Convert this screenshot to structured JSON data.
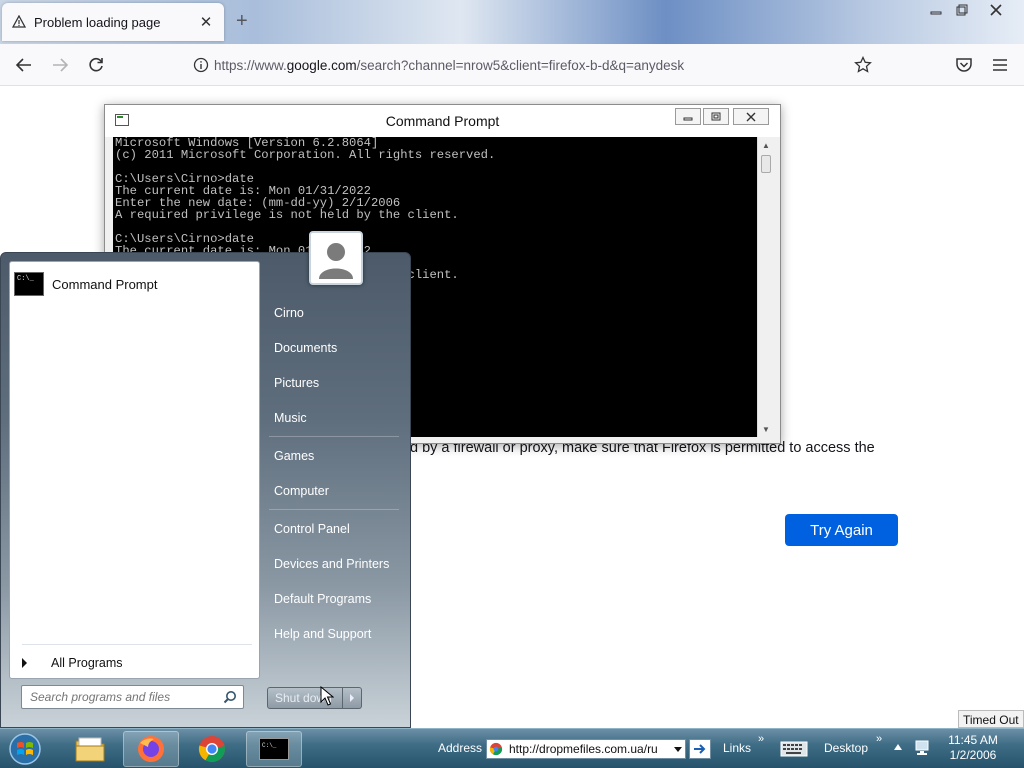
{
  "browser": {
    "tab_title": "Problem loading page",
    "new_tab": "+",
    "url_prefix": "https://www.",
    "url_domain": "google.com",
    "url_rest": "/search?channel=nrow5&client=firefox-b-d&q=anydesk"
  },
  "page": {
    "error_text": "d by a firewall or proxy, make sure that Firefox is permitted to access the",
    "try_again": "Try Again"
  },
  "cmd": {
    "title": "Command Prompt",
    "console": "Microsoft Windows [Version 6.2.8064]\n(c) 2011 Microsoft Corporation. All rights reserved.\n\nC:\\Users\\Cirno>date\nThe current date is: Mon 01/31/2022\nEnter the new date: (mm-dd-yy) 2/1/2006\nA required privilege is not held by the client.\n\nC:\\Users\\Cirno>date\nThe current date is: Mon 01/31/2022\nEnter the new date: (mm-dd-yy) 2/1/2006\nA required privilege is not held by the client."
  },
  "start_menu": {
    "pinned": "Command Prompt",
    "all_programs": "All Programs",
    "search_placeholder": "Search programs and files",
    "right_items": [
      "Cirno",
      "Documents",
      "Pictures",
      "Music",
      "Games",
      "Computer",
      "Control Panel",
      "Devices and Printers",
      "Default Programs",
      "Help and Support"
    ],
    "shutdown": "Shut down"
  },
  "status": {
    "timed_out": "Timed Out"
  },
  "taskbar": {
    "address_label": "Address",
    "address_value": "http://dropmefiles.com.ua/ru",
    "links_label": "Links",
    "desktop_label": "Desktop",
    "time": "11:45 AM",
    "date": "1/2/2006"
  },
  "colors": {
    "accent": "#0061e0",
    "console_bg": "#000000",
    "console_fg": "#c0c0c0"
  }
}
